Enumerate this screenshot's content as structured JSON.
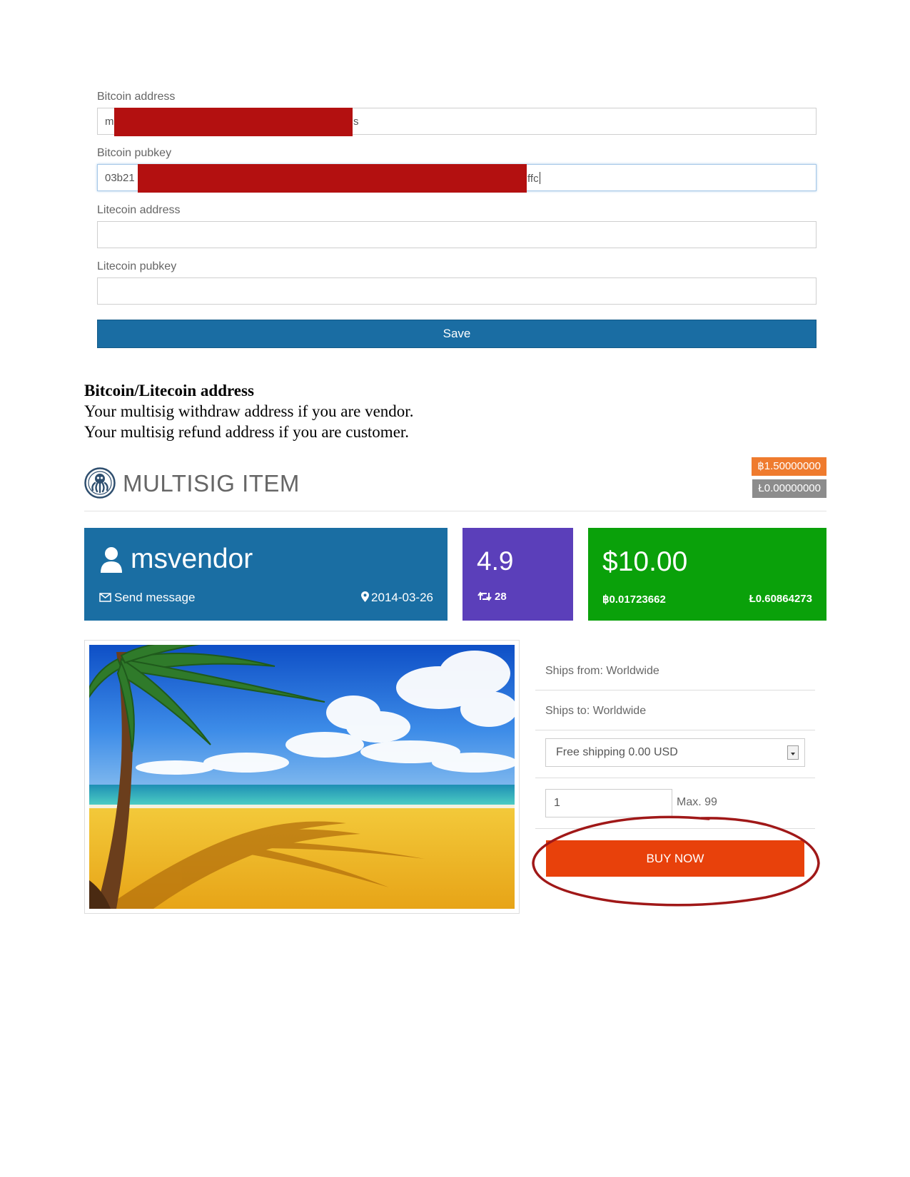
{
  "form": {
    "bitcoin_address": {
      "label": "Bitcoin address",
      "value_start": "m",
      "value_end": "s"
    },
    "bitcoin_pubkey": {
      "label": "Bitcoin pubkey",
      "value_start": "03b21",
      "value_end": "ffc"
    },
    "litecoin_address": {
      "label": "Litecoin address",
      "value": ""
    },
    "litecoin_pubkey": {
      "label": "Litecoin pubkey",
      "value": ""
    },
    "save_label": "Save"
  },
  "doc": {
    "heading": "Bitcoin/Litecoin address",
    "line1": "Your multisig withdraw address if you are vendor.",
    "line2": "Your multisig refund address if you are customer."
  },
  "item": {
    "title": "MULTISIG ITEM",
    "btc_badge": "฿1.50000000",
    "ltc_badge": "Ł0.00000000",
    "vendor_name": "msvendor",
    "send_message": "Send message",
    "vendor_date": "2014-03-26",
    "rating": "4.9",
    "rating_count": "28",
    "price_usd": "$10.00",
    "price_btc": "฿0.01723662",
    "price_ltc": "Ł0.60864273",
    "ships_from": "Ships from: Worldwide",
    "ships_to": "Ships to: Worldwide",
    "shipping_option": "Free shipping 0.00 USD",
    "quantity": "1",
    "max_label": "Max. 99",
    "buy_label": "BUY NOW"
  },
  "colors": {
    "save_button": "#1a6da3",
    "vendor_tile": "#1a6ea3",
    "rating_tile": "#5b3fba",
    "price_tile": "#0aa10a",
    "btc_badge": "#ef7b2e",
    "ltc_badge": "#8c8c8c",
    "buy_button": "#e8410b",
    "annotation_circle": "#a01818",
    "redaction": "#b31010"
  }
}
